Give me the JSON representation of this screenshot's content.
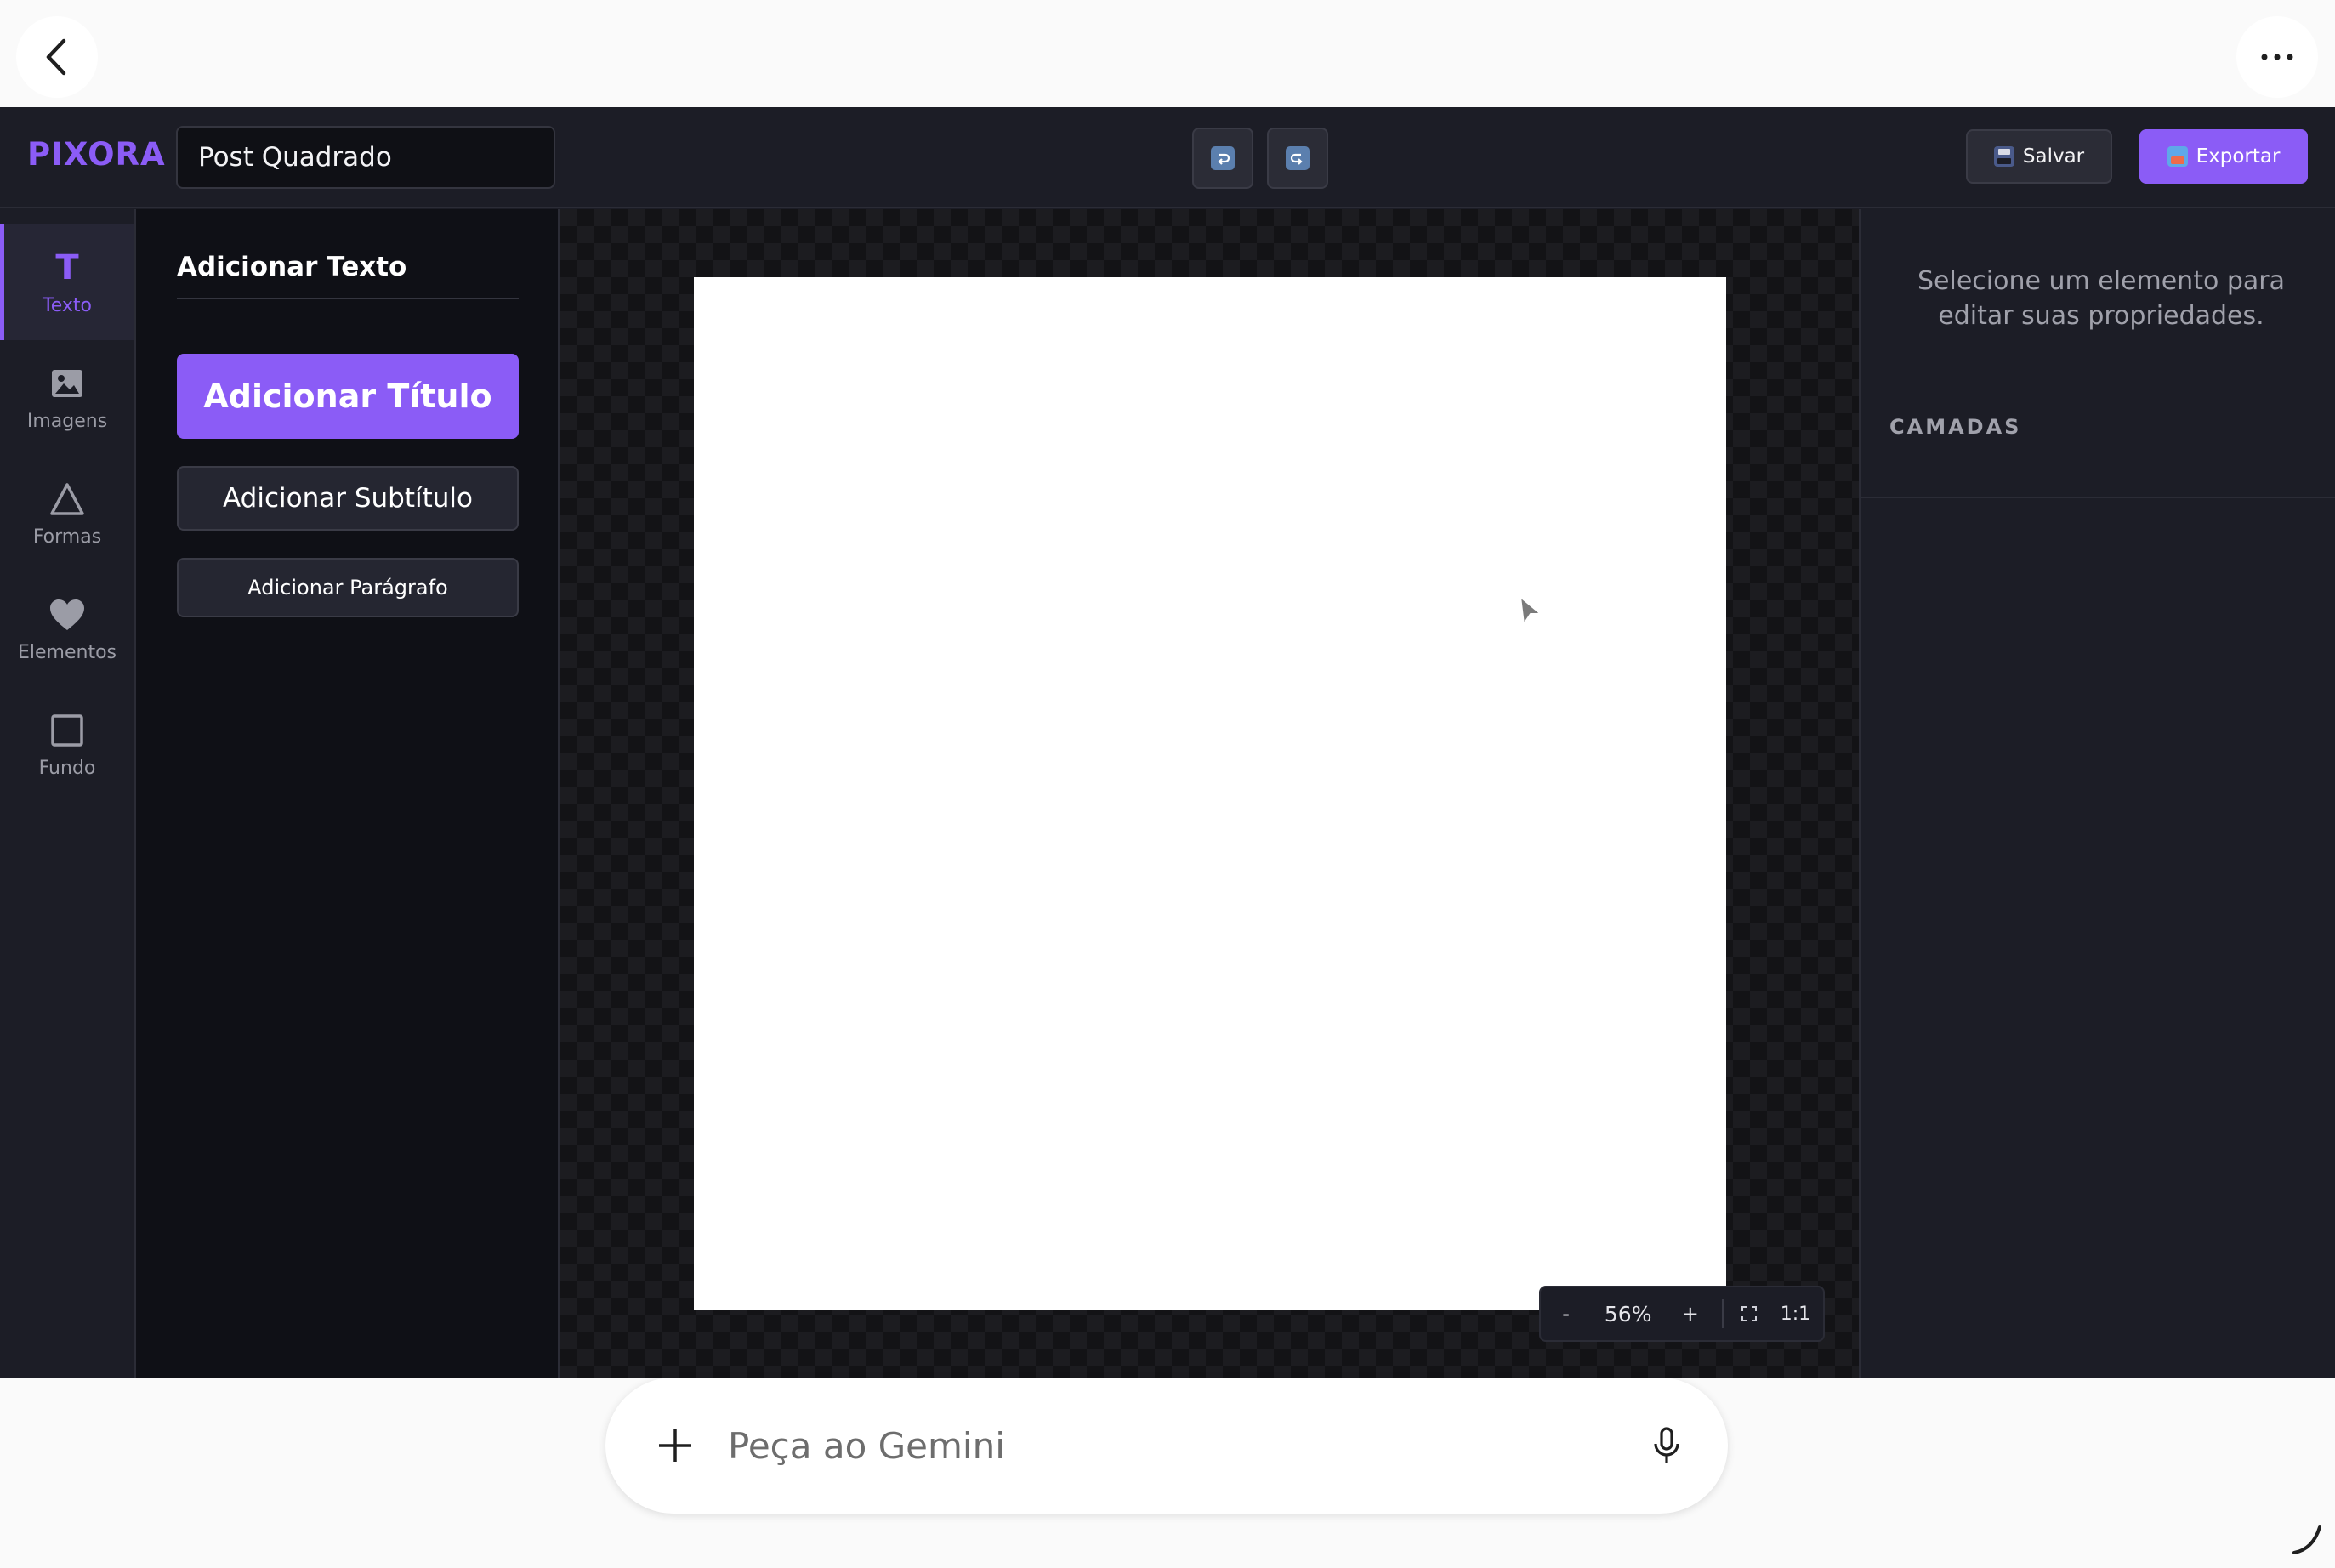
{
  "browser": {
    "back_icon": "chevron-left-icon",
    "more_icon": "more-horizontal-icon"
  },
  "header": {
    "logo": "PIXORA",
    "document_title": "Post Quadrado",
    "undo_icon": "undo-icon",
    "redo_icon": "redo-icon",
    "save_label": "Salvar",
    "export_label": "Exportar",
    "accent_color": "#8b5cf6"
  },
  "rail": {
    "items": [
      {
        "label": "Texto",
        "icon": "text-icon",
        "active": true
      },
      {
        "label": "Imagens",
        "icon": "image-icon",
        "active": false
      },
      {
        "label": "Formas",
        "icon": "triangle-icon",
        "active": false
      },
      {
        "label": "Elementos",
        "icon": "heart-icon",
        "active": false
      },
      {
        "label": "Fundo",
        "icon": "square-icon",
        "active": false
      }
    ]
  },
  "panel": {
    "title": "Adicionar Texto",
    "add_title": "Adicionar Título",
    "add_subtitle": "Adicionar Subtítulo",
    "add_paragraph": "Adicionar Parágrafo"
  },
  "zoom": {
    "minus": "-",
    "value": "56%",
    "plus": "+",
    "fit_icon": "fit-screen-icon",
    "one_to_one": "1:1"
  },
  "properties": {
    "hint": "Selecione um elemento para editar suas propriedades.",
    "layers_title": "CAMADAS"
  },
  "gemini": {
    "placeholder": "Peça ao Gemini",
    "plus_icon": "plus-icon",
    "mic_icon": "microphone-icon"
  }
}
